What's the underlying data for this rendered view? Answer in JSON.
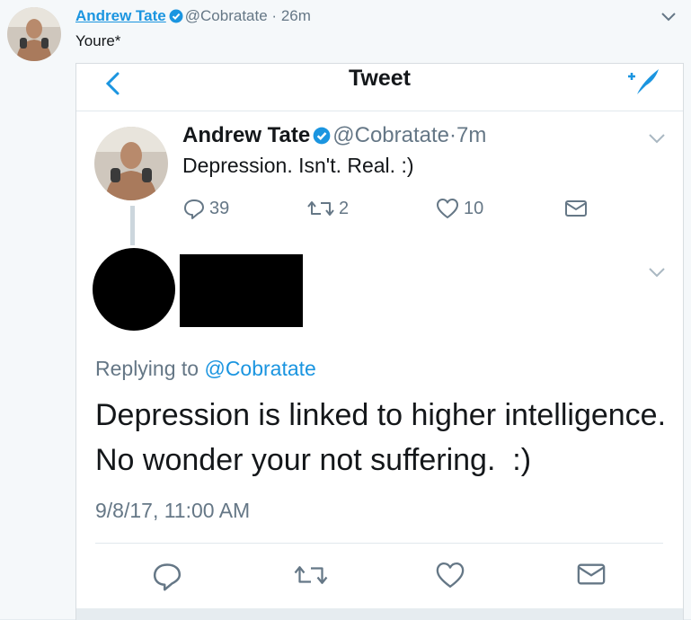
{
  "outer": {
    "name": "Andrew Tate",
    "handle": "@Cobratate",
    "separator": "·",
    "time": "26m",
    "text": "Youre*"
  },
  "screenshot": {
    "nav_title": "Tweet",
    "original": {
      "name": "Andrew Tate",
      "handle": "@Cobratate",
      "separator": "·",
      "time": "7m",
      "text": "Depression. Isn't. Real. :)",
      "reply_count": "39",
      "retweet_count": "2",
      "like_count": "10"
    },
    "reply": {
      "replying_prefix": "Replying to",
      "replying_handle": "@Cobratate",
      "line1": "Depression is linked to higher intelligence.",
      "line2": "No wonder your not suffering.  :)",
      "timestamp": "9/8/17, 11:00 AM"
    }
  },
  "colors": {
    "accent": "#1b95e0",
    "muted": "#657786",
    "redaction": "#000000"
  },
  "icons": [
    "verified-badge-icon",
    "chevron-down-icon",
    "back-icon",
    "compose-icon",
    "reply-icon",
    "retweet-icon",
    "like-icon",
    "dm-icon"
  ]
}
